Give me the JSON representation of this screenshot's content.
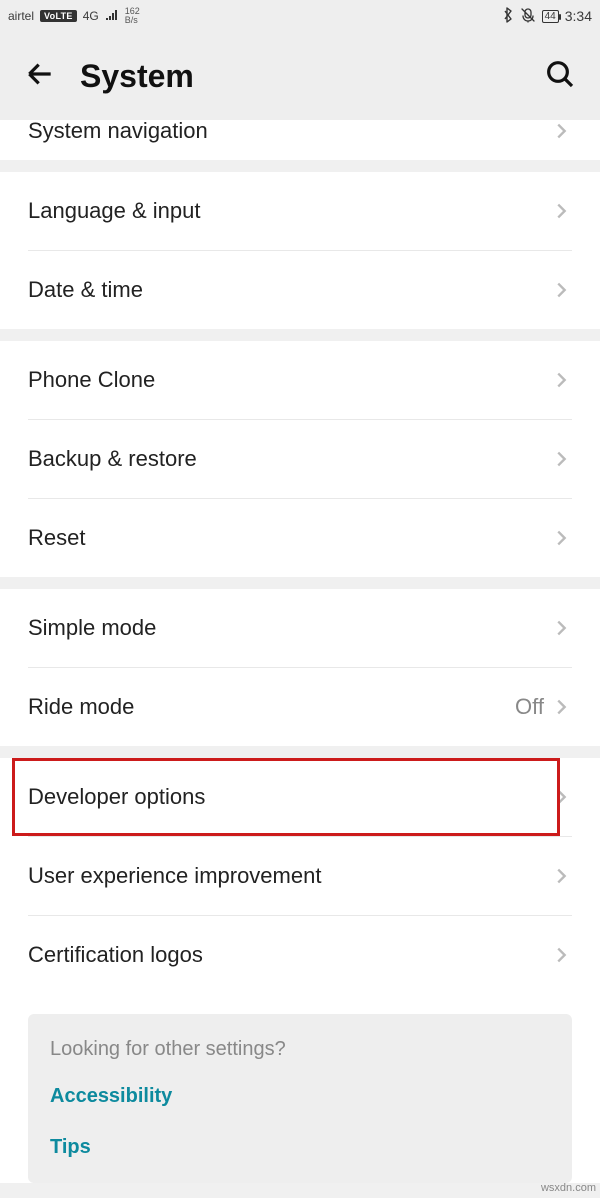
{
  "status": {
    "carrier": "airtel",
    "volte": "VoLTE",
    "network_gen": "4G",
    "data_rate_top": "162",
    "data_rate_bottom": "B/s",
    "battery": "44",
    "clock": "3:34"
  },
  "header": {
    "title": "System"
  },
  "rows": {
    "system_navigation": "System navigation",
    "language_input": "Language & input",
    "date_time": "Date & time",
    "phone_clone": "Phone Clone",
    "backup_restore": "Backup & restore",
    "reset": "Reset",
    "simple_mode": "Simple mode",
    "ride_mode": "Ride mode",
    "ride_mode_value": "Off",
    "developer_options": "Developer options",
    "user_experience": "User experience improvement",
    "cert_logos": "Certification logos"
  },
  "help": {
    "question": "Looking for other settings?",
    "accessibility": "Accessibility",
    "tips": "Tips"
  },
  "watermark": "wsxdn.com"
}
